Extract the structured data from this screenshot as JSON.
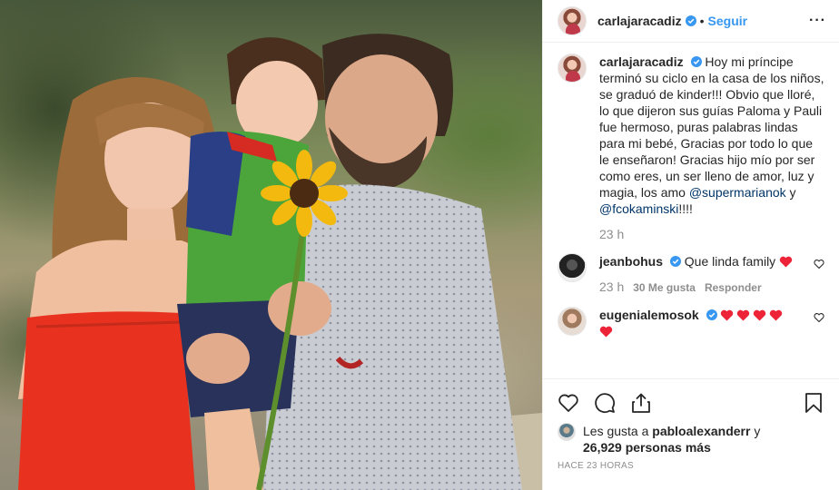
{
  "post": {
    "author": "carlajaracadiz",
    "follow_label": "Seguir",
    "separator": "•",
    "more_label": "···"
  },
  "caption": {
    "username": "carlajaracadiz",
    "text": "Hoy mi príncipe terminó su ciclo en la casa de los niños, se graduó de kinder!!! Obvio que lloré, lo que dijeron sus guías Paloma y Pauli fue hermoso, puras palabras lindas para mi bebé, Gracias por todo lo que le enseñaron! Gracias hijo mío por ser como eres, un ser lleno de amor, luz y magia, los amo ",
    "mention1": "@supermarianok",
    "joiner": " y ",
    "mention2": "@fcokaminski",
    "tail": "!!!!",
    "time": "23 h"
  },
  "comments": [
    {
      "username": "jeanbohus",
      "text": "Que linda family",
      "hearts": 1,
      "time": "23 h",
      "likes": "30 Me gusta",
      "reply": "Responder"
    },
    {
      "username": "eugenialemosok",
      "text": "",
      "hearts": 5
    }
  ],
  "likes": {
    "prefix": "Les gusta a ",
    "user": "pabloalexanderr",
    "joiner": " y",
    "count": "26,929 personas más"
  },
  "timestamp": "HACE 23 HORAS",
  "colors": {
    "link": "#3897f0",
    "mention": "#003569",
    "heart": "#ed4956",
    "muted": "#8e8e8e"
  }
}
